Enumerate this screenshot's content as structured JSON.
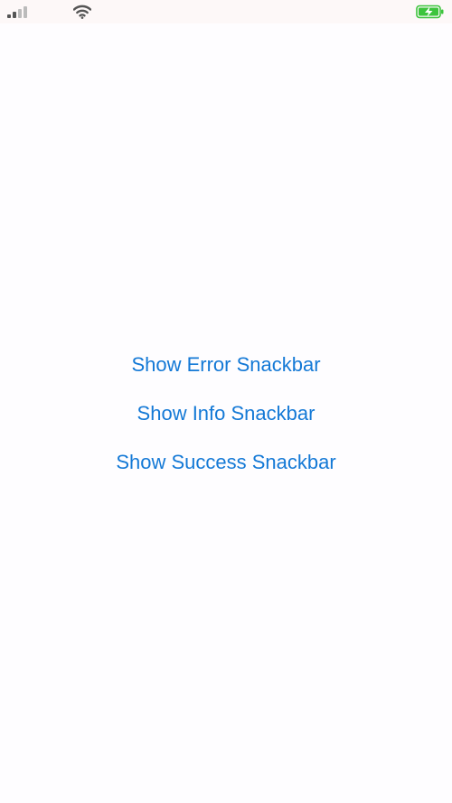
{
  "colors": {
    "accent": "#1479d6",
    "background": "#fefdff",
    "status_bar_bg": "#fdf8f8",
    "battery_green": "#3cc43c"
  },
  "status_bar": {
    "icons": [
      "cellular-signal-icon",
      "wifi-icon",
      "battery-charging-icon"
    ]
  },
  "buttons": [
    {
      "label": "Show Error Snackbar"
    },
    {
      "label": "Show Info Snackbar"
    },
    {
      "label": "Show Success Snackbar"
    }
  ]
}
